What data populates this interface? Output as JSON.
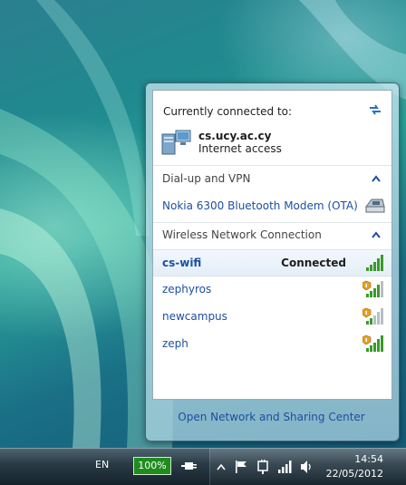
{
  "flyout": {
    "header_title": "Currently connected to:",
    "current_network": {
      "name": "cs.ucy.ac.cy",
      "access": "Internet access"
    },
    "dialup_section": {
      "label": "Dial-up and VPN",
      "items": [
        {
          "label": "Nokia 6300 Bluetooth Modem (OTA)",
          "icon": "modem-icon"
        }
      ]
    },
    "wireless_section": {
      "label": "Wireless Network Connection",
      "networks": [
        {
          "name": "cs-wifi",
          "status": "Connected",
          "secured": false,
          "signal_bars": 5
        },
        {
          "name": "zephyros",
          "status": "",
          "secured": true,
          "signal_bars": 4
        },
        {
          "name": "newcampus",
          "status": "",
          "secured": true,
          "signal_bars": 2
        },
        {
          "name": "zeph",
          "status": "",
          "secured": true,
          "signal_bars": 5
        }
      ]
    },
    "footer_link": "Open Network and Sharing Center"
  },
  "taskbar": {
    "language": "EN",
    "battery_percent": "100%",
    "time": "14:54",
    "date": "22/05/2012",
    "tray_icons": [
      "chevron-up-icon",
      "flag-icon",
      "power-plug-icon",
      "network-signal-icon",
      "speaker-icon"
    ]
  },
  "colors": {
    "link": "#1d4fa0",
    "battery_green": "#1f8c1f",
    "signal_green": "#3a9a2a"
  }
}
